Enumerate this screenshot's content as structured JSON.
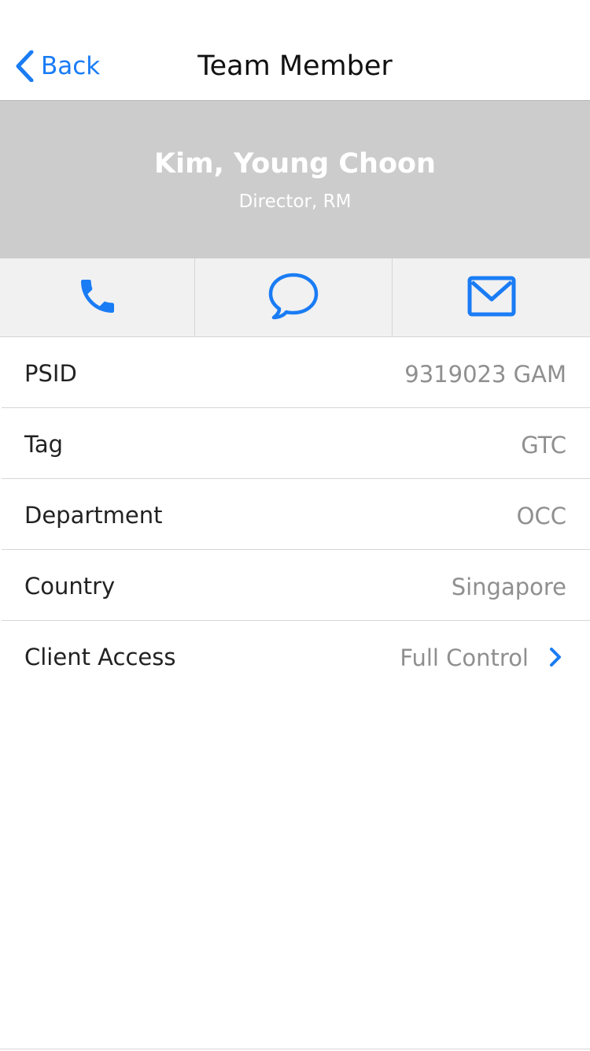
{
  "navbar": {
    "back_label": "Back",
    "title": "Team Member"
  },
  "profile": {
    "name": "Kim, Young Choon",
    "role": "Director, RM"
  },
  "actions": [
    {
      "name": "call",
      "icon": "phone-icon"
    },
    {
      "name": "message",
      "icon": "chat-bubble-icon"
    },
    {
      "name": "email",
      "icon": "envelope-icon"
    }
  ],
  "details": [
    {
      "label": "PSID",
      "value": "9319023 GAM"
    },
    {
      "label": "Tag",
      "value": "GTC"
    },
    {
      "label": "Department",
      "value": "OCC"
    },
    {
      "label": "Country",
      "value": "Singapore"
    },
    {
      "label": "Client Access",
      "value": "Full Control",
      "icon": "chevron-right-icon"
    }
  ],
  "colors": {
    "accent": "#1a7cf5",
    "header_bg": "#cccccc",
    "action_bar_bg": "#f1f1f1",
    "value_text": "#8f8f8f",
    "divider": "#d6d6d6"
  }
}
